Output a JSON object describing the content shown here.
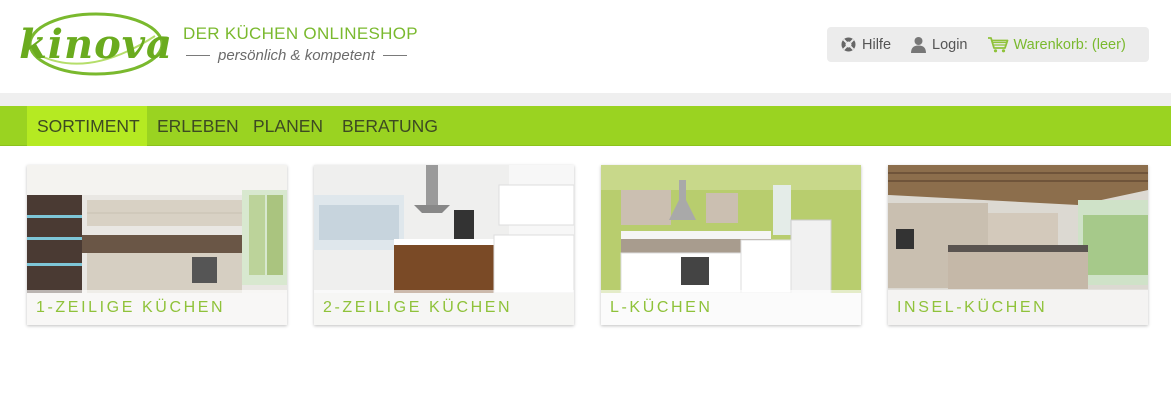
{
  "brand": {
    "logo_text": "kinova",
    "title": "DER KÜCHEN ONLINESHOP",
    "subtitle": "persönlich & kompetent",
    "accent_color": "#9ad321"
  },
  "utility": {
    "help": {
      "label": "Hilfe",
      "icon": "help-lifebuoy-icon"
    },
    "login": {
      "label": "Login",
      "icon": "user-icon"
    },
    "cart": {
      "label": "Warenkorb: (leer)",
      "icon": "shopping-cart-icon"
    }
  },
  "nav": {
    "items": [
      {
        "label": "SORTIMENT",
        "active": true
      },
      {
        "label": "ERLEBEN",
        "active": false
      },
      {
        "label": "PLANEN",
        "active": false
      },
      {
        "label": "BERATUNG",
        "active": false
      }
    ]
  },
  "tiles": [
    {
      "label": "1-ZEILIGE KÜCHEN"
    },
    {
      "label": "2-ZEILIGE KÜCHEN"
    },
    {
      "label": "L-KÜCHEN"
    },
    {
      "label": "INSEL-KÜCHEN"
    }
  ]
}
